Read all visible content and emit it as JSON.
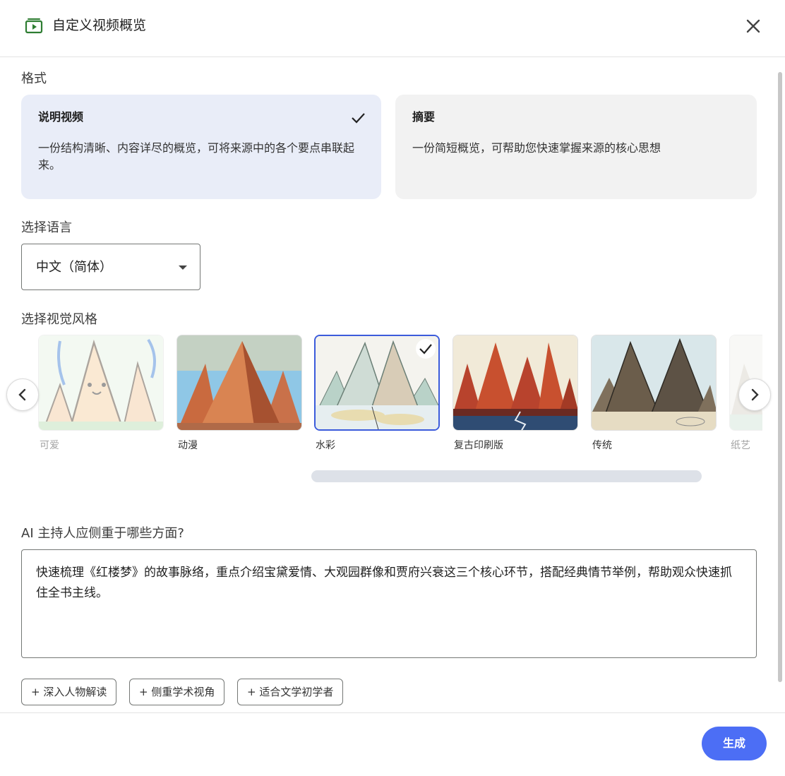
{
  "header": {
    "title": "自定义视频概览"
  },
  "format": {
    "label": "格式",
    "options": [
      {
        "title": "说明视频",
        "description": "一份结构清晰、内容详尽的概览，可将来源中的各个要点串联起来。",
        "selected": true
      },
      {
        "title": "摘要",
        "description": "一份简短概览，可帮助您快速掌握来源的核心思想",
        "selected": false
      }
    ]
  },
  "language": {
    "label": "选择语言",
    "value": "中文（简体）"
  },
  "visual_style": {
    "label": "选择视觉风格",
    "selected": "水彩",
    "styles": [
      {
        "name": "可爱"
      },
      {
        "name": "动漫"
      },
      {
        "name": "水彩"
      },
      {
        "name": "复古印刷版"
      },
      {
        "name": "传统"
      },
      {
        "name": "纸艺"
      }
    ]
  },
  "focus": {
    "label": "AI 主持人应侧重于哪些方面?",
    "prompt": "快速梳理《红楼梦》的故事脉络，重点介绍宝黛爱情、大观园群像和贾府兴衰这三个核心环节，搭配经典情节举例，帮助观众快速抓住全书主线。",
    "suggestions": [
      "+ 深入人物解读",
      "+ 侧重学术视角",
      "+ 适合文学初学者"
    ]
  },
  "footer": {
    "generate_label": "生成"
  },
  "colors": {
    "accent": "#4c6ef5",
    "selected_card": "#e9edf8",
    "selected_border": "#3b5bdb"
  }
}
